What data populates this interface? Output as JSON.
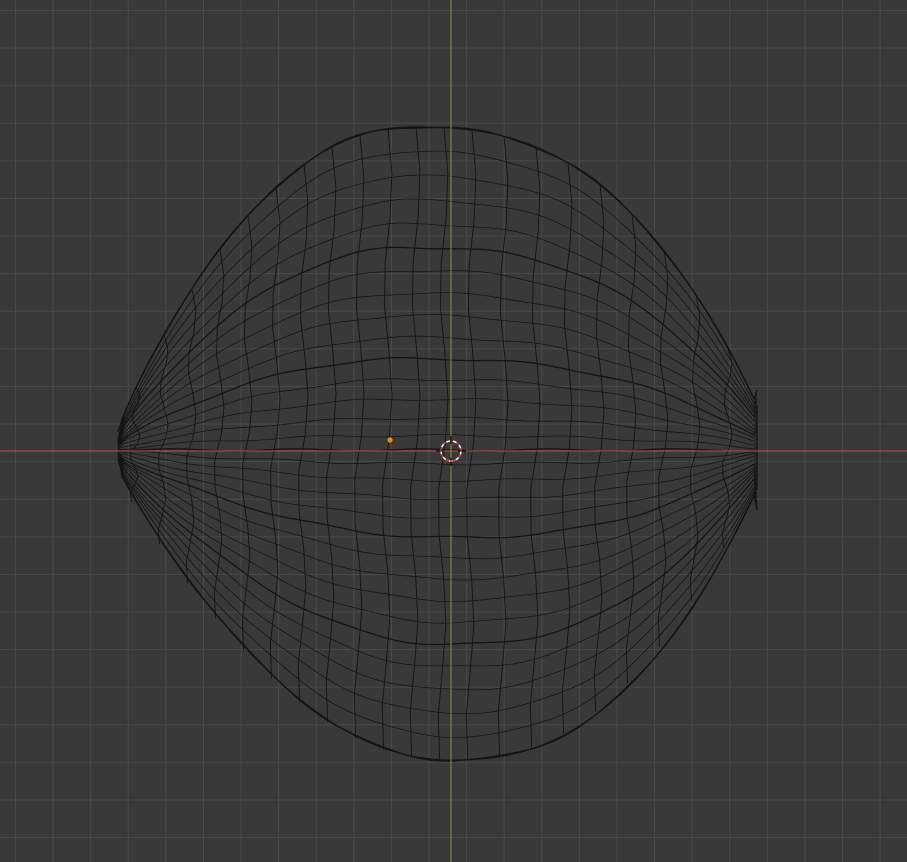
{
  "view": {
    "background_color": "#393939",
    "grid_color": "#4a4a4a",
    "x_axis_color": "#c0505a",
    "y_axis_color": "#7a9a3a",
    "wire_color": "#141414",
    "origin_color": "#f08a28",
    "cursor_colors": [
      "#d83a3a",
      "#ffffff"
    ]
  }
}
